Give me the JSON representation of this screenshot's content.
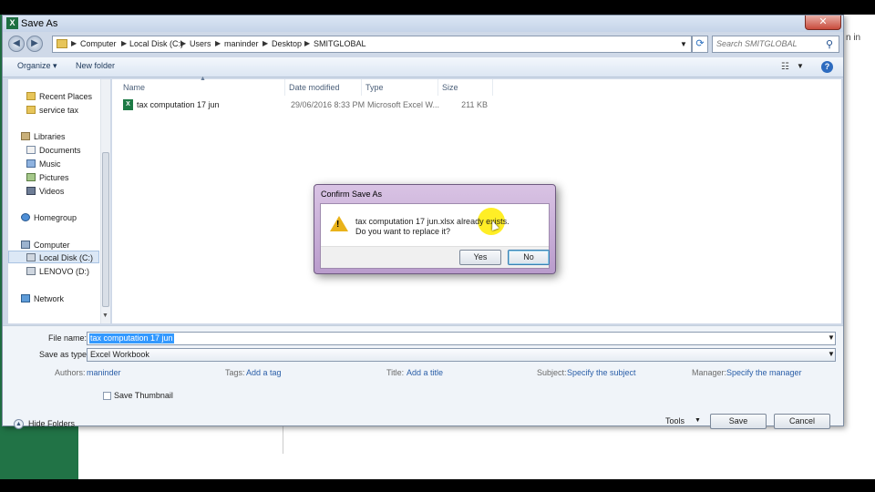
{
  "window_title": "Save As",
  "address": {
    "crumbs": [
      "Computer",
      "Local Disk (C:)",
      "Users",
      "maninder",
      "Desktop",
      "SMITGLOBAL"
    ]
  },
  "search": {
    "placeholder": "Search SMITGLOBAL"
  },
  "toolbar": {
    "organize": "Organize ▾",
    "new_folder": "New folder"
  },
  "sidebar": {
    "items": [
      {
        "label": "Recent Places",
        "icon": "recent-places-icon"
      },
      {
        "label": "service tax",
        "icon": "folder-icon"
      },
      {
        "label": "Libraries",
        "icon": "libraries-icon"
      },
      {
        "label": "Documents",
        "icon": "documents-icon"
      },
      {
        "label": "Music",
        "icon": "music-icon"
      },
      {
        "label": "Pictures",
        "icon": "pictures-icon"
      },
      {
        "label": "Videos",
        "icon": "videos-icon"
      },
      {
        "label": "Homegroup",
        "icon": "homegroup-icon"
      },
      {
        "label": "Computer",
        "icon": "computer-icon"
      },
      {
        "label": "Local Disk (C:)",
        "icon": "drive-icon"
      },
      {
        "label": "LENOVO (D:)",
        "icon": "drive-icon"
      },
      {
        "label": "Network",
        "icon": "network-icon"
      }
    ]
  },
  "files": {
    "columns": [
      "Name",
      "Date modified",
      "Type",
      "Size"
    ],
    "rows": [
      {
        "name": "tax computation 17 jun",
        "date": "29/06/2016 8:33 PM",
        "type": "Microsoft Excel W...",
        "size": "211 KB"
      }
    ]
  },
  "form": {
    "file_name_label": "File name:",
    "file_name_value": "tax computation 17 jun",
    "save_as_type_label": "Save as type:",
    "save_as_type_value": "Excel Workbook",
    "authors_label": "Authors:",
    "authors_value": "maninder",
    "tags_label": "Tags:",
    "tags_value": "Add a tag",
    "title_label": "Title:",
    "title_value": "Add a title",
    "subject_label": "Subject:",
    "subject_value": "Specify the subject",
    "manager_label": "Manager:",
    "manager_value": "Specify the manager",
    "save_thumbnail": "Save Thumbnail",
    "hide_folders": "Hide Folders",
    "tools": "Tools",
    "save": "Save",
    "cancel": "Cancel"
  },
  "confirm": {
    "title": "Confirm Save As",
    "message_line1": "tax computation 17 jun.xlsx already exists.",
    "message_line2": "Do you want to replace it?",
    "yes": "Yes",
    "no": "No"
  },
  "background": {
    "side_text": "n in"
  },
  "colors": {
    "excel_green": "#217346",
    "title_red": "#c8102e",
    "selection_blue": "#3399ff",
    "link_blue": "#2a5ea8"
  }
}
